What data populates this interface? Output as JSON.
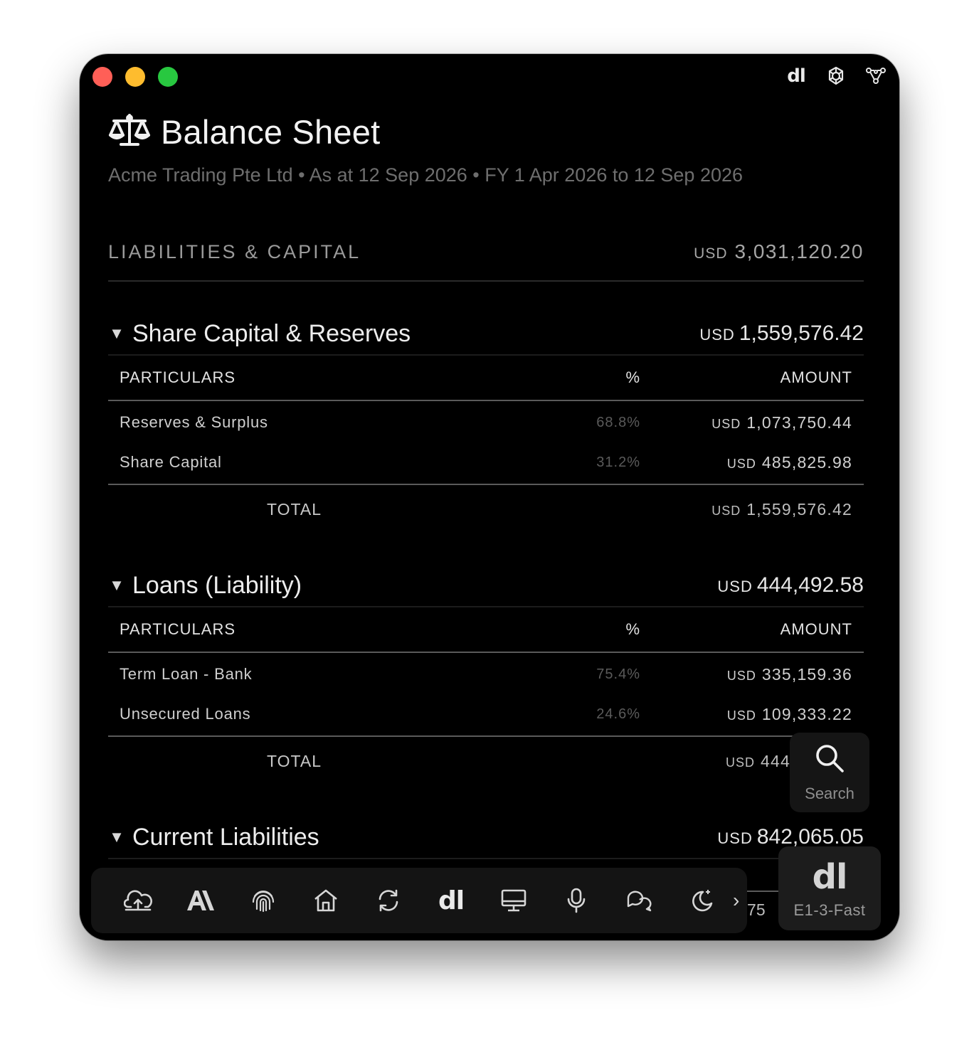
{
  "window": {
    "title_icons": [
      "dl-logo-icon",
      "openai-knot-icon",
      "nodes-icon"
    ],
    "dl_logo_text": "dl"
  },
  "header": {
    "title": "Balance Sheet",
    "icon": "scales-icon",
    "subtitle": "Acme Trading Pte Ltd • As at 12 Sep 2026 • FY 1 Apr 2026 to 12 Sep 2026"
  },
  "liabilities_capital": {
    "label": "LIABILITIES & CAPITAL",
    "currency": "USD",
    "total": "3,031,120.20"
  },
  "table_headers": {
    "particulars": "PARTICULARS",
    "percent": "%",
    "amount": "AMOUNT",
    "total_label": "TOTAL"
  },
  "sections": [
    {
      "name": "Share Capital & Reserves",
      "currency": "USD",
      "total": "1,559,576.42",
      "rows": [
        {
          "particular": "Reserves & Surplus",
          "percent": "68.8%",
          "currency": "USD",
          "amount": "1,073,750.44"
        },
        {
          "particular": "Share Capital",
          "percent": "31.2%",
          "currency": "USD",
          "amount": "485,825.98"
        }
      ],
      "footer_currency": "USD",
      "footer_total": "1,559,576.42"
    },
    {
      "name": "Loans (Liability)",
      "currency": "USD",
      "total": "444,492.58",
      "rows": [
        {
          "particular": "Term Loan - Bank",
          "percent": "75.4%",
          "currency": "USD",
          "amount": "335,159.36"
        },
        {
          "particular": "Unsecured Loans",
          "percent": "24.6%",
          "currency": "USD",
          "amount": "109,333.22"
        }
      ],
      "footer_currency": "USD",
      "footer_total": "444,"
    },
    {
      "name": "Current Liabilities",
      "currency": "USD",
      "total": "842,065.05"
    }
  ],
  "dock": {
    "items": [
      "cloud-upload-icon",
      "anthropic-icon",
      "fingerprint-icon",
      "home-icon",
      "refresh-icon",
      "dl-icon",
      "monitor-icon",
      "microphone-icon",
      "chat-icon",
      "moon-sparkle-icon"
    ],
    "dl_text": "dl",
    "more": "›",
    "peek_amount": "› 75"
  },
  "search": {
    "label": "Search"
  },
  "model": {
    "logo_text": "dl",
    "label": "E1-3-Fast"
  }
}
